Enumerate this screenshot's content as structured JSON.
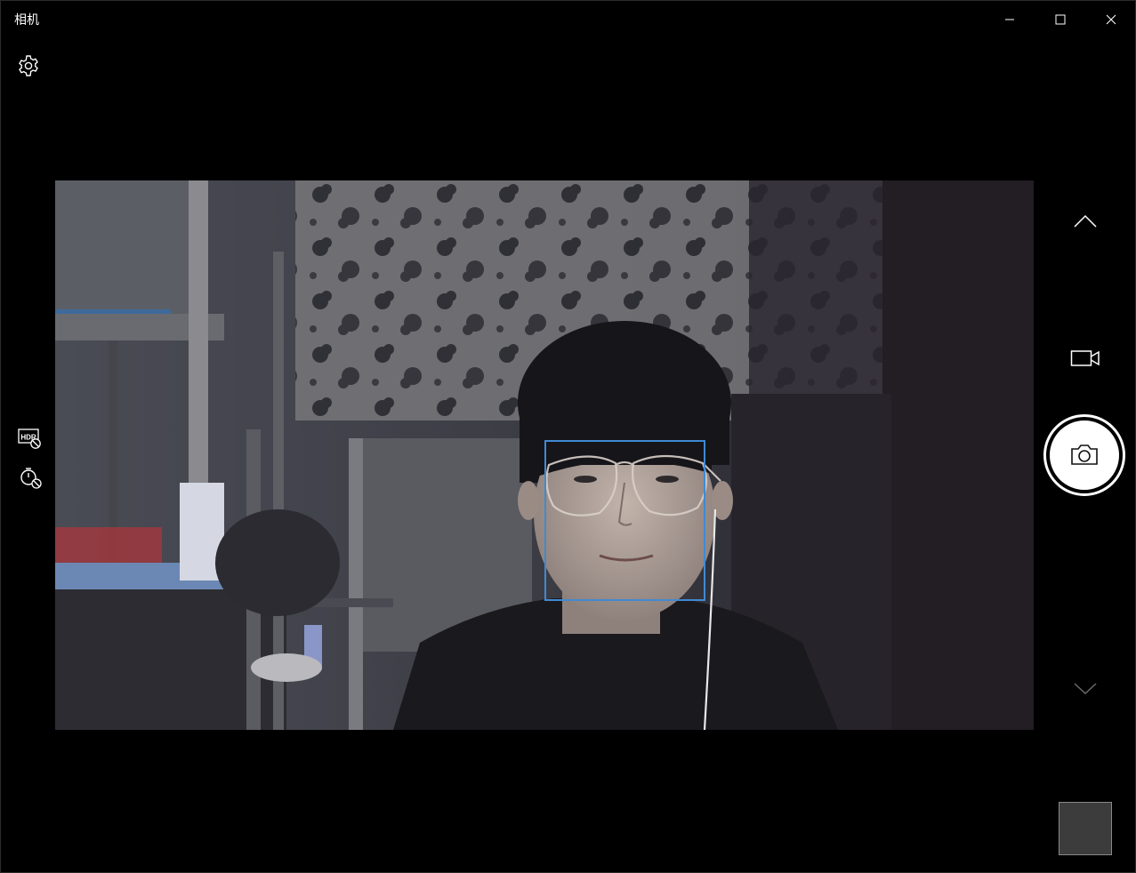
{
  "window": {
    "title": "相机",
    "controls": {
      "minimize_icon": "minimize-icon",
      "maximize_icon": "maximize-icon",
      "close_icon": "close-icon"
    }
  },
  "toolbar": {
    "settings_icon": "gear-icon"
  },
  "left_tools": [
    {
      "name": "hdr-toggle",
      "icon": "hdr-off-icon",
      "label": "HDR"
    },
    {
      "name": "timer-toggle",
      "icon": "timer-off-icon"
    }
  ],
  "right_rail": {
    "up_icon": "chevron-up-icon",
    "video_mode_icon": "video-camera-icon",
    "shutter_icon": "camera-icon",
    "down_icon": "chevron-down-icon"
  },
  "viewfinder": {
    "face_detection": true,
    "accent_color": "#3f8ad3"
  },
  "gallery": {
    "thumbnail_color": "#3c3c3c"
  }
}
